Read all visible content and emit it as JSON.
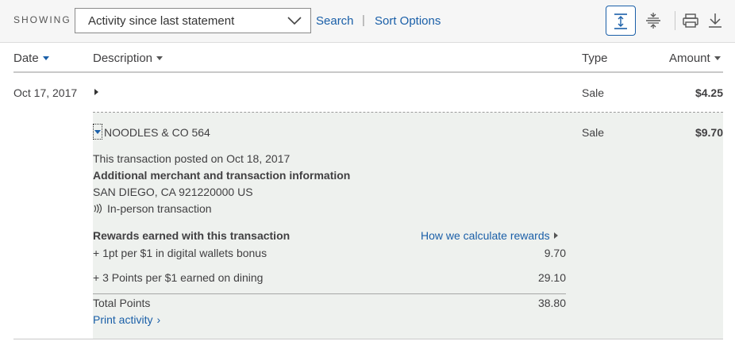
{
  "toolbar": {
    "showing_label": "SHOWING",
    "select_value": "Activity since last statement",
    "search_link": "Search",
    "separator": "|",
    "sort_options_link": "Sort Options"
  },
  "columns": {
    "date": "Date",
    "description": "Description",
    "type": "Type",
    "amount": "Amount"
  },
  "rows": [
    {
      "date": "Oct 17, 2017",
      "description": "",
      "type": "Sale",
      "amount": "$4.25"
    }
  ],
  "expanded": {
    "merchant": "NOODLES & CO 564",
    "type": "Sale",
    "amount": "$9.70",
    "posted": "This transaction posted on Oct 18, 2017",
    "info_heading": "Additional merchant and transaction information",
    "location": "SAN DIEGO, CA 921220000 US",
    "method": "In-person transaction",
    "rewards_heading": "Rewards earned with this transaction",
    "rewards_link": "How we calculate rewards",
    "rewards": [
      {
        "label": "+ 1pt per $1 in digital wallets bonus",
        "value": "9.70"
      },
      {
        "label": "+ 3 Points per $1 earned on dining",
        "value": "29.10"
      }
    ],
    "total_label": "Total Points",
    "total_value": "38.80",
    "print_link": "Print activity"
  },
  "colors": {
    "link": "#1a5fa8",
    "toolbar_bg": "#f6f6f6",
    "expanded_bg": "#eef1ee"
  }
}
